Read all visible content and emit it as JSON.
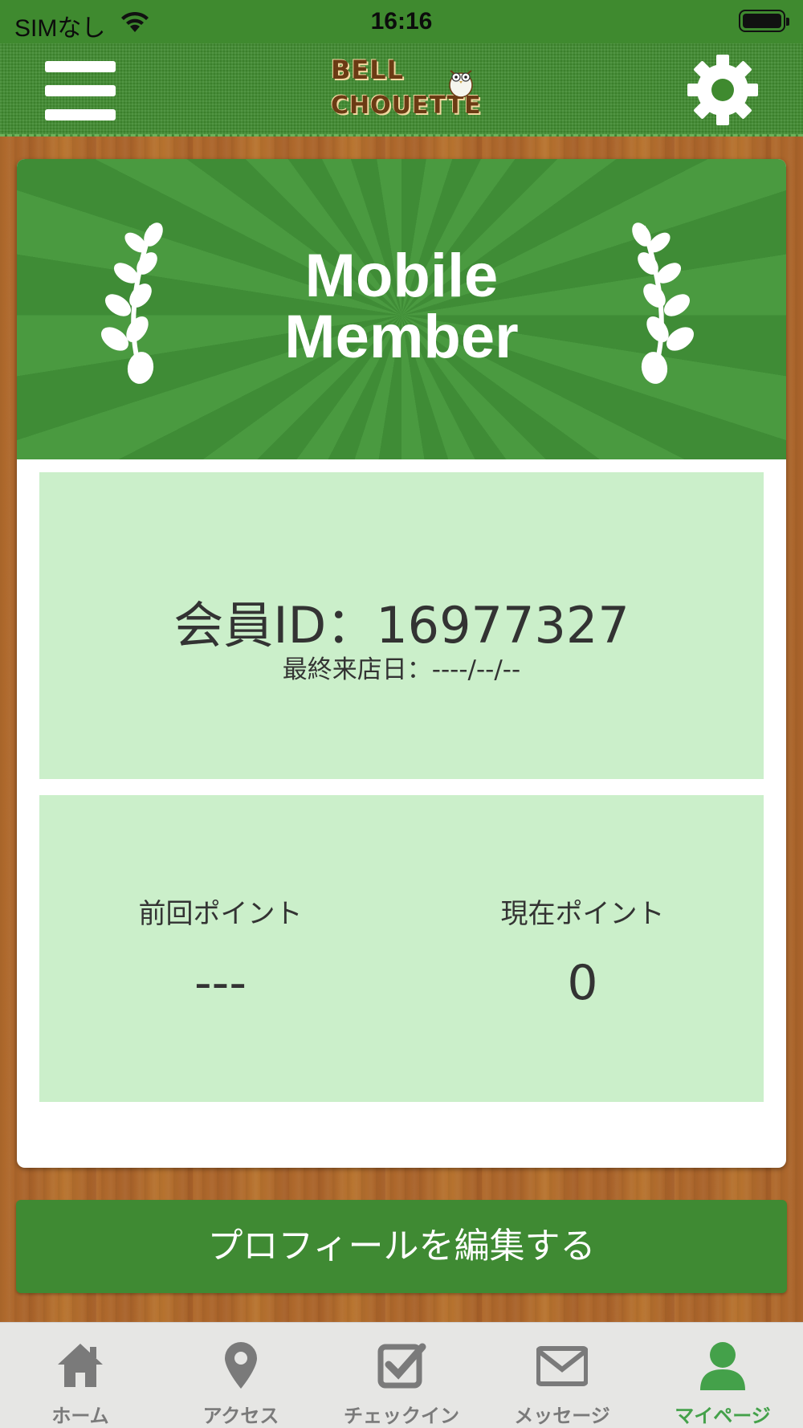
{
  "status_bar": {
    "carrier": "SIMなし",
    "time": "16:16"
  },
  "header": {
    "logo_line1": "BELL",
    "logo_line2": "CHOUETTE",
    "menu_icon": "hamburger-icon",
    "settings_icon": "gear-icon"
  },
  "card": {
    "title_line1": "Mobile",
    "title_line2": "Member",
    "member_id": "会員ID：16977327",
    "last_visit": "最終来店日：----/--/--",
    "prev_points_label": "前回ポイント",
    "prev_points_value": "---",
    "current_points_label": "現在ポイント",
    "current_points_value": "0"
  },
  "edit_profile_label": "プロフィールを編集する",
  "tabs": [
    {
      "label": "ホーム",
      "icon": "home-icon",
      "active": false
    },
    {
      "label": "アクセス",
      "icon": "map-pin-icon",
      "active": false
    },
    {
      "label": "チェックイン",
      "icon": "checkbox-icon",
      "active": false
    },
    {
      "label": "メッセージ",
      "icon": "envelope-icon",
      "active": false
    },
    {
      "label": "マイページ",
      "icon": "user-icon",
      "active": true
    }
  ],
  "colors": {
    "header_green": "#3f8a2f",
    "panel_green": "#cbefca",
    "active_tab": "#44a14a"
  }
}
